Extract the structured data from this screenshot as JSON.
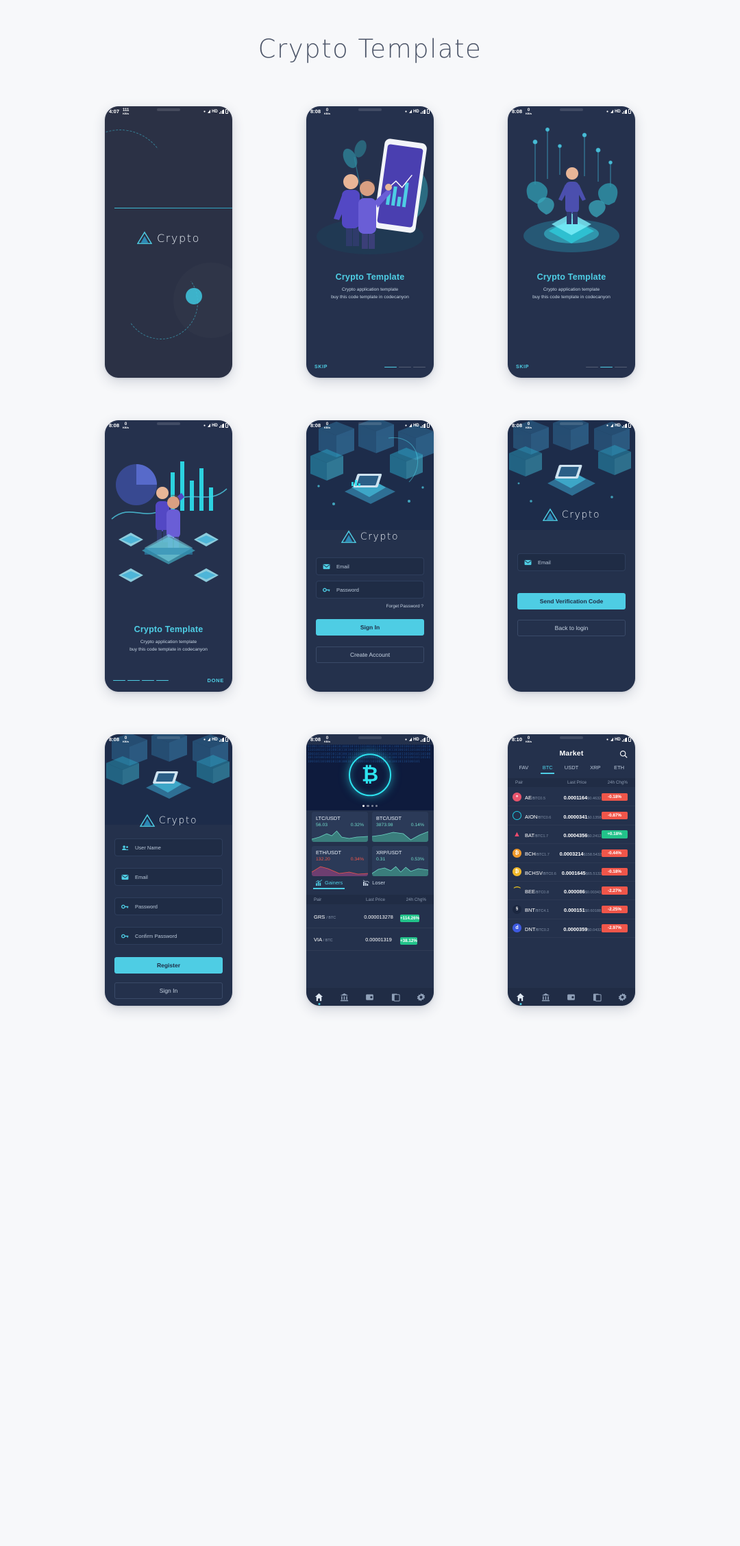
{
  "page": {
    "title": "Crypto Template"
  },
  "screens": {
    "splash": {
      "status": {
        "time": "4:07",
        "net": "111",
        "net_unit": "KB/s",
        "hd": "HD"
      },
      "logo_text": "Crypto"
    },
    "onboard1": {
      "status": {
        "time": "8:08",
        "net": "0",
        "net_unit": "KB/s",
        "hd": "HD"
      },
      "title": "Crypto Template",
      "subtitle_line1": "Crypto application template",
      "subtitle_line2": "buy this code template in codecanyon",
      "skip": "SKIP"
    },
    "onboard2": {
      "status": {
        "time": "8:08",
        "net": "0",
        "net_unit": "KB/s",
        "hd": "HD"
      },
      "title": "Crypto Template",
      "subtitle_line1": "Crypto application template",
      "subtitle_line2": "buy this code template in codecanyon",
      "skip": "SKIP"
    },
    "onboard3": {
      "status": {
        "time": "8:08",
        "net": "0",
        "net_unit": "KB/s",
        "hd": "HD"
      },
      "title": "Crypto Template",
      "subtitle_line1": "Crypto application template",
      "subtitle_line2": "buy this code template in codecanyon",
      "done": "DONE"
    },
    "signin": {
      "status": {
        "time": "8:08",
        "net": "0",
        "net_unit": "KB/s",
        "hd": "HD"
      },
      "logo_text": "Crypto",
      "email_placeholder": "Email",
      "password_placeholder": "Password",
      "forgot": "Forget Password ?",
      "sign_in": "Sign In",
      "create_account": "Create Account"
    },
    "forgot": {
      "status": {
        "time": "8:08",
        "net": "0",
        "net_unit": "KB/s",
        "hd": "HD"
      },
      "logo_text": "Crypto",
      "email_placeholder": "Email",
      "send_code": "Send Verification Code",
      "back_to_login": "Back to login"
    },
    "register": {
      "status": {
        "time": "8:08",
        "net": "0",
        "net_unit": "KB/s",
        "hd": "HD"
      },
      "logo_text": "Crypto",
      "username_placeholder": "User Name",
      "email_placeholder": "Email",
      "password_placeholder": "Password",
      "confirm_placeholder": "Confirm Password",
      "register": "Register",
      "sign_in": "Sign In"
    },
    "home": {
      "status": {
        "time": "8:08",
        "net": "0",
        "net_unit": "KB/s",
        "hd": "HD"
      },
      "price_cards": [
        {
          "pair": "LTC/USDT",
          "price": "56.03",
          "change": "0.32%",
          "dir": "up"
        },
        {
          "pair": "BTC/USDT",
          "price": "3873.98",
          "change": "0.14%",
          "dir": "up"
        },
        {
          "pair": "ETH/USDT",
          "price": "132.20",
          "change": "0.34%",
          "dir": "down"
        },
        {
          "pair": "XRP/USDT",
          "price": "0.31",
          "change": "0.53%",
          "dir": "up"
        }
      ],
      "tabs": [
        {
          "label": "Gainers",
          "active": true,
          "icon": "chart-up-icon"
        },
        {
          "label": "Loser",
          "active": false,
          "icon": "chart-down-icon"
        }
      ],
      "columns": {
        "pair": "Pair",
        "last_price": "Last Price",
        "change": "24h Chg%"
      },
      "rows": [
        {
          "base": "GRS",
          "quote": "/ BTC",
          "price": "0.000013278",
          "change": "+114.26%",
          "dir": "up"
        },
        {
          "base": "VIA",
          "quote": "/ BTC",
          "price": "0.00001319",
          "change": "+38.12%",
          "dir": "up"
        }
      ]
    },
    "market": {
      "status": {
        "time": "8:10",
        "net": "0",
        "net_unit": "KB/s",
        "hd": "HD"
      },
      "title": "Market",
      "search_icon": "search-icon",
      "tabs": [
        {
          "label": "FAV",
          "active": false
        },
        {
          "label": "BTC",
          "active": true
        },
        {
          "label": "USDT",
          "active": false
        },
        {
          "label": "XRP",
          "active": false
        },
        {
          "label": "ETH",
          "active": false
        }
      ],
      "columns": {
        "pair": "Pair",
        "last_price": "Last Price",
        "change": "24h Chg%"
      },
      "rows": [
        {
          "base": "AE",
          "quote": "/BTC",
          "vol": "0.5",
          "price": "0.0001164",
          "usd": "$0.4632",
          "change": "-0.18%",
          "dir": "dn",
          "color": "#e8556d",
          "glyph": "oo"
        },
        {
          "base": "AION",
          "quote": "/BTC",
          "vol": "0.6",
          "price": "0.0000341",
          "usd": "$0.1358",
          "change": "-0.87%",
          "dir": "dn",
          "color": "#1fc8e0",
          "glyph": "O"
        },
        {
          "base": "BAT",
          "quote": "/BTC",
          "vol": "1.7",
          "price": "0.0004356",
          "usd": "$0.2412",
          "change": "+0.18%",
          "dir": "up",
          "color": "#f04a6e",
          "glyph": "▲"
        },
        {
          "base": "BCH",
          "quote": "/BTC",
          "vol": "1.7",
          "price": "0.0003214",
          "usd": "$158.5432",
          "change": "-0.44%",
          "dir": "dn",
          "color": "#f0992a",
          "glyph": "Ƀ"
        },
        {
          "base": "BCHSV",
          "quote": "/BTC",
          "vol": "0.6",
          "price": "0.0001645",
          "usd": "$65.5132",
          "change": "-0.18%",
          "dir": "dn",
          "color": "#f0b82a",
          "glyph": "Ƀ"
        },
        {
          "base": "BEE",
          "quote": "/BTC",
          "vol": "0.8",
          "price": "0.000086",
          "usd": "$0.00343",
          "change": "-2.27%",
          "dir": "dn",
          "color": "#e8c220",
          "glyph": "◠"
        },
        {
          "base": "BNT",
          "quote": "/BTC",
          "vol": "4.1",
          "price": "0.000151",
          "usd": "$0.60188",
          "change": "-2.25%",
          "dir": "dn",
          "color": "#1b2740",
          "glyph": "§"
        },
        {
          "base": "DNT",
          "quote": "/BTC",
          "vol": "0.2",
          "price": "0.0000359",
          "usd": "$0.0432",
          "change": "-2.97%",
          "dir": "dn",
          "color": "#3e5ae0",
          "glyph": "d"
        }
      ]
    }
  },
  "nav": [
    {
      "icon": "home-icon",
      "active": true
    },
    {
      "icon": "bank-icon",
      "active": false
    },
    {
      "icon": "wallet-icon",
      "active": false
    },
    {
      "icon": "ledger-icon",
      "active": false
    },
    {
      "icon": "gear-icon",
      "active": false
    }
  ],
  "colors": {
    "accent": "#4ecde4",
    "up": "#22c38a",
    "down": "#f0564a",
    "bg": "#24314c",
    "page_bg": "#f7f8fa"
  }
}
